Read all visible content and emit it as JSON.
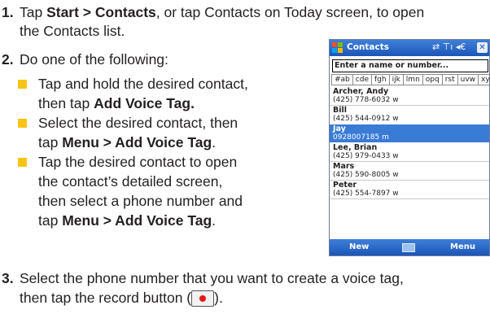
{
  "steps": {
    "s1": {
      "num": "1.",
      "l1_pre": "Tap ",
      "l1_bold": "Start > Contacts",
      "l1_post": ", or tap Contacts on Today screen, to open",
      "l2": "the Contacts list."
    },
    "s2": {
      "num": "2.",
      "text": "Do one of the following:"
    },
    "bullets": {
      "b1": {
        "l1": "Tap and hold the desired contact,",
        "l2_pre": "then tap ",
        "l2_bold": "Add Voice Tag."
      },
      "b2": {
        "l1": "Select the desired contact, then",
        "l2_pre": "tap ",
        "l2_bold": "Menu > Add Voice Tag",
        "l2_post": "."
      },
      "b3": {
        "l1": "Tap the desired contact to open",
        "l2": "the contact’s detailed screen,",
        "l3": "then select a phone number and",
        "l4_pre": "tap ",
        "l4_bold": "Menu > Add Voice Tag",
        "l4_post": "."
      }
    },
    "s3": {
      "num": "3.",
      "l1": "Select the phone number that you want to create a voice tag,",
      "l2_pre": "then tap the record button (",
      "l2_post": ")."
    }
  },
  "phone": {
    "title": "Contacts",
    "status_icons": "⇄ ⊤ı ◂€",
    "close": "✕",
    "search_placeholder": "Enter a name or number...",
    "tabs": [
      "#ab",
      "cde",
      "fgh",
      "ijk",
      "lmn",
      "opq",
      "rst",
      "uvw",
      "xyz"
    ],
    "contacts": [
      {
        "name": "Archer, Andy",
        "phone": "(425) 778-6032  w",
        "selected": false
      },
      {
        "name": "Bill",
        "phone": "(425) 544-0912  w",
        "selected": false
      },
      {
        "name": "Jay",
        "phone": "0928007185  m",
        "selected": true
      },
      {
        "name": "Lee, Brian",
        "phone": "(425) 979-0433  w",
        "selected": false
      },
      {
        "name": "Mars",
        "phone": "(425) 590-8005  w",
        "selected": false
      },
      {
        "name": "Peter",
        "phone": "(425) 554-7897  w",
        "selected": false
      }
    ],
    "softkey_left": "New",
    "softkey_right": "Menu"
  },
  "colors": {
    "bullet": "#f7c417",
    "titlebar": "#1c56b8",
    "selection": "#3a7bd5",
    "record_dot": "#e11b1b"
  }
}
